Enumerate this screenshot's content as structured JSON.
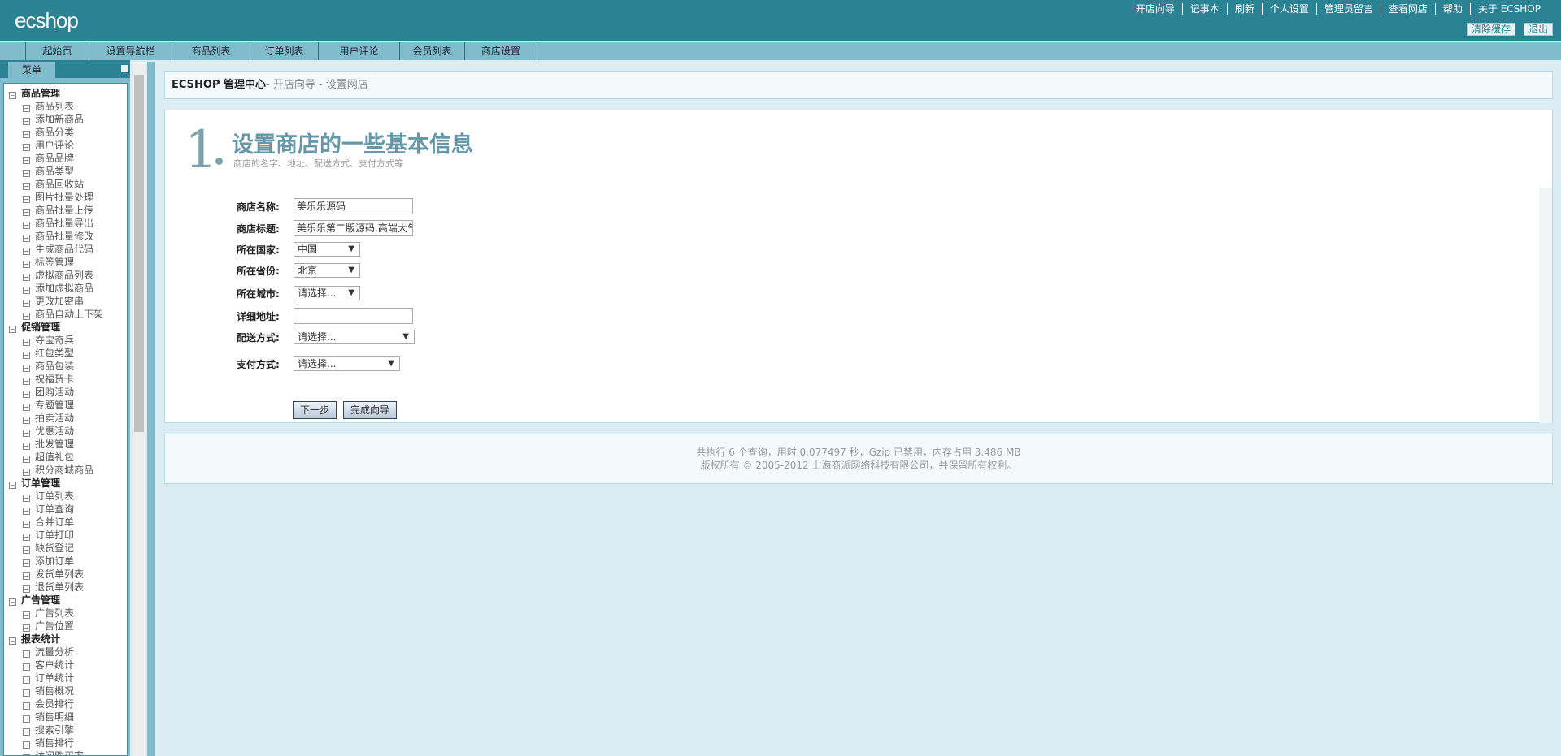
{
  "header": {
    "logo": "ecshop",
    "links": [
      "开店向导",
      "记事本",
      "刷新",
      "个人设置",
      "管理员留言",
      "查看网店",
      "帮助",
      "关于 ECSHOP"
    ],
    "buttons": [
      "清除缓存",
      "退出"
    ]
  },
  "nav": {
    "tabs": [
      "起始页",
      "设置导航栏",
      "商品列表",
      "订单列表",
      "用户评论",
      "会员列表",
      "商店设置"
    ]
  },
  "menu": {
    "title": "菜单",
    "groups": [
      {
        "label": "商品管理",
        "items": [
          "商品列表",
          "添加新商品",
          "商品分类",
          "用户评论",
          "商品品牌",
          "商品类型",
          "商品回收站",
          "图片批量处理",
          "商品批量上传",
          "商品批量导出",
          "商品批量修改",
          "生成商品代码",
          "标签管理",
          "虚拟商品列表",
          "添加虚拟商品",
          "更改加密串",
          "商品自动上下架"
        ]
      },
      {
        "label": "促销管理",
        "items": [
          "夺宝奇兵",
          "红包类型",
          "商品包装",
          "祝福贺卡",
          "团购活动",
          "专题管理",
          "拍卖活动",
          "优惠活动",
          "批发管理",
          "超值礼包",
          "积分商城商品"
        ]
      },
      {
        "label": "订单管理",
        "items": [
          "订单列表",
          "订单查询",
          "合并订单",
          "订单打印",
          "缺货登记",
          "添加订单",
          "发货单列表",
          "退货单列表"
        ]
      },
      {
        "label": "广告管理",
        "items": [
          "广告列表",
          "广告位置"
        ]
      },
      {
        "label": "报表统计",
        "items": [
          "流量分析",
          "客户统计",
          "订单统计",
          "销售概况",
          "会员排行",
          "销售明细",
          "搜索引擎",
          "销售排行",
          "访问购买率"
        ]
      }
    ]
  },
  "breadcrumb": {
    "root": "ECSHOP 管理中心",
    "path": "- 开店向导 - 设置网店"
  },
  "wizard": {
    "step": "1",
    "title": "设置商店的一些基本信息",
    "subtitle": "商店的名字、地址、配送方式、支付方式等",
    "fields": [
      {
        "label": "商店名称:",
        "value": "美乐乐源码"
      },
      {
        "label": "商店标题:",
        "value": "美乐乐第二版源码,高端大气"
      },
      {
        "label": "所在国家:",
        "value": "中国"
      },
      {
        "label": "所在省份:",
        "value": "北京"
      },
      {
        "label": "所在城市:",
        "value": "请选择..."
      },
      {
        "label": "详细地址:",
        "value": ""
      },
      {
        "label": "配送方式:",
        "value": "请选择..."
      },
      {
        "label": "支付方式:",
        "value": "请选择..."
      }
    ],
    "next": "下一步",
    "finish": "完成向导"
  },
  "footer": {
    "line1": "共执行 6 个查询，用时 0.077497 秒，Gzip 已禁用，内存占用 3.486 MB",
    "line2": "版权所有 © 2005-2012 上海商派网络科技有限公司，并保留所有权利。"
  }
}
